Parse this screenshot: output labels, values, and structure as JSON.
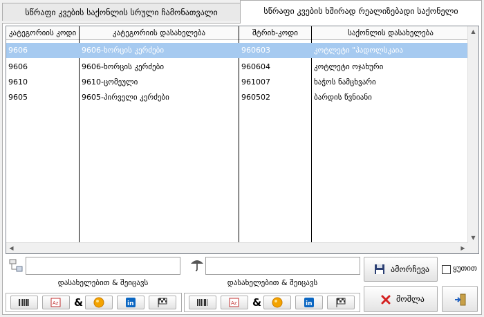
{
  "tabs": [
    {
      "label": "სწრაფი კვების საქონლის სრული ჩამონათვალი"
    },
    {
      "label": "სწრაფი კვების ხშირად რეალიზებადი საქონელი"
    }
  ],
  "grid": {
    "columns": [
      "კატეგორიის კოდი",
      "კატეგორიის დასახელება",
      "შტრიხ-კოდი",
      "საქონლის დასახელება"
    ],
    "rows": [
      [
        "9606",
        "9606-ხორცის კერძები",
        "960603",
        "კოტლეტი \"პადოლსკაია"
      ],
      [
        "9606",
        "9606-ხორცის კერძები",
        "960604",
        "კოტლეტი ოჯახური"
      ],
      [
        "9610",
        "9610-ცომეული",
        "961007",
        "ხაჭოს ნამცხვარი"
      ],
      [
        "9605",
        "9605-პირველი კერძები",
        "960502",
        "ბარდის წვნიანი"
      ]
    ],
    "selected_row": 0
  },
  "left_search": {
    "value": "",
    "caption": "დასახელებით & შეიცავს"
  },
  "right_search": {
    "value": "",
    "caption": "დასახელებით & შეიცავს"
  },
  "filter_button_text": {
    "amp": "&"
  },
  "actions": {
    "select_label": "ამორჩევა",
    "cancel_label": "მოშლა",
    "box_label": "ყუთით",
    "box_checked": false
  },
  "icons": [
    "folder-tree-icon",
    "umbrella-icon",
    "barcode-icon",
    "az-sort-icon",
    "orange-circle-icon",
    "linkedin-icon",
    "checkered-flag-icon",
    "save-disk-icon",
    "red-x-icon",
    "exit-door-icon"
  ],
  "colors": {
    "selection": "#a6caf0",
    "cancel_x": "#d42020"
  }
}
